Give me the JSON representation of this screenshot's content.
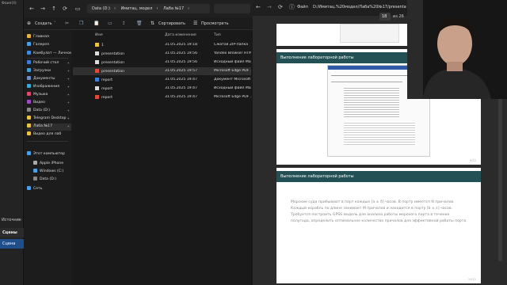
{
  "obs": {
    "top_label": "Фаил(II)",
    "sources_label": "Источник",
    "scenes_label": "Сцены",
    "scene_item": "Сцена"
  },
  "explorer": {
    "breadcrumbs": [
      "Data (D:)",
      "Имитац. модел",
      "Лаба №17"
    ],
    "toolbar": {
      "create": "Создать",
      "sort": "Сортировать",
      "view": "Просмотреть"
    },
    "sidebar": [
      {
        "label": "Главная",
        "color": "#e8b04a"
      },
      {
        "label": "Галерея",
        "color": "#4aa0e8"
      },
      {
        "label": "Камбулат — Личное",
        "color": "#3c8de0"
      },
      {
        "label": "Рабочий стол",
        "color": "#3c7fd8"
      },
      {
        "label": "Загрузки",
        "color": "#3c9fd8"
      },
      {
        "label": "Документы",
        "color": "#6a8fc8"
      },
      {
        "label": "Изображения",
        "color": "#3ca8d8"
      },
      {
        "label": "Музыка",
        "color": "#e04a6a"
      },
      {
        "label": "Видео",
        "color": "#a04ac8"
      },
      {
        "label": "Data (D:)",
        "color": "#888888"
      },
      {
        "label": "Telegram Desktop",
        "color": "#e8c24a"
      },
      {
        "label": "Лаба №17",
        "color": "#e8c24a"
      },
      {
        "label": "Видео для лаб",
        "color": "#e8c24a"
      },
      {
        "label": "Этот компьютер",
        "color": "#4aa0e8"
      },
      {
        "label": "Apple iPhone",
        "color": "#aaaaaa"
      },
      {
        "label": "Windows (C:)",
        "color": "#4aa0e8"
      },
      {
        "label": "Data (D:)",
        "color": "#888888"
      },
      {
        "label": "Сеть",
        "color": "#4aa0e8"
      }
    ],
    "columns": {
      "name": "Имя",
      "date": "Дата изменения",
      "type": "Тип"
    },
    "files": [
      {
        "name": "1",
        "date": "31.05.2025 19:18",
        "type": "Сжатая ZIP-папка",
        "icon_color": "#e8c24a"
      },
      {
        "name": "presentation",
        "date": "31.05.2025 19:56",
        "type": "Yandex Browser HTM...",
        "icon_color": "#dddddd"
      },
      {
        "name": "presentation",
        "date": "31.05.2025 19:56",
        "type": "Исходный файл Mar...",
        "icon_color": "#dddddd"
      },
      {
        "name": "presentation",
        "date": "31.05.2025 19:57",
        "type": "Microsoft Edge PDF ...",
        "icon_color": "#e04a3a"
      },
      {
        "name": "report",
        "date": "31.05.2025 19:47",
        "type": "Документ Microsoft ...",
        "icon_color": "#3c7fd8"
      },
      {
        "name": "report",
        "date": "31.05.2025 19:47",
        "type": "Исходный файл Mar...",
        "icon_color": "#dddddd"
      },
      {
        "name": "report",
        "date": "31.05.2025 19:47",
        "type": "Microsoft Edge PDF ...",
        "icon_color": "#e04a3a"
      }
    ],
    "selected_index": 3
  },
  "viewer": {
    "file_label": "Файл",
    "url": "D:/Имитац.%20модел/Лаба%20№17/presentatio",
    "page_current": "18",
    "page_total": "из 26",
    "slide1_heading": "Выполнение лабораторной работы",
    "slide1_num": "9/12",
    "slide2_heading": "Выполнение лабораторной работы",
    "slide2_text": "Морские суда прибывают в порт каждые [a ± δ] часов. В порту имеется N причалов. Каждый корабль по длине занимает M причалов и находится в порту [b ± ε] часов. Требуется построить GPSS модель для анализа работы морского порта в течение полугода, определить оптимальное количество причалов для эффективной работы порта.",
    "slide2_num": "10/12"
  }
}
